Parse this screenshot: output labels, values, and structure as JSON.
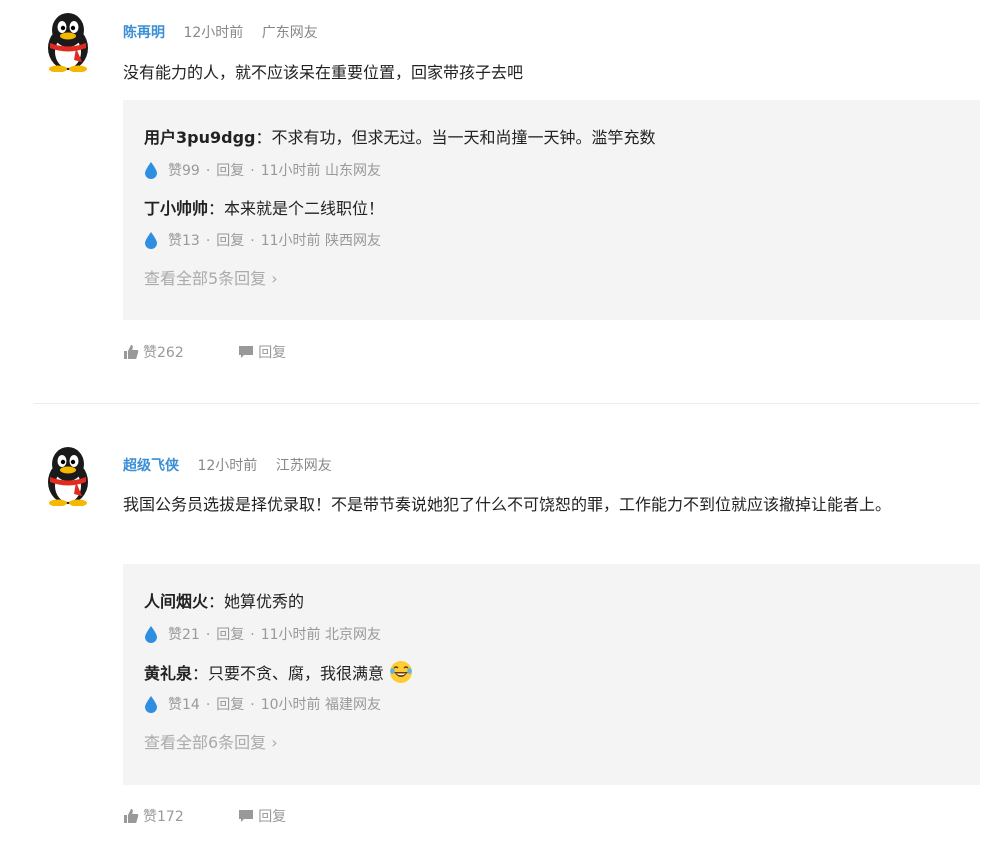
{
  "comments": [
    {
      "author": "陈再明",
      "time": "12小时前",
      "location": "广东网友",
      "text": "没有能力的人，就不应该呆在重要位置，回家带孩子去吧",
      "replies": [
        {
          "author": "用户3pu9dgg",
          "sep": "：",
          "text": "不求有功，但求无过。当一天和尚撞一天钟。滥竽充数",
          "likes": "赞99",
          "dot": "·",
          "reply_label": "回复",
          "time": "11小时前",
          "location": "山东网友"
        },
        {
          "author": "丁小帅帅",
          "sep": "：",
          "text": "本来就是个二线职位！",
          "likes": "赞13",
          "dot": "·",
          "reply_label": "回复",
          "time": "11小时前",
          "location": "陕西网友"
        }
      ],
      "more_replies": "查看全部5条回复",
      "more_chevron": "›",
      "likes": "赞262",
      "reply_label": "回复"
    },
    {
      "author": "超级飞侠",
      "time": "12小时前",
      "location": "江苏网友",
      "text": "我国公务员选拔是择优录取！不是带节奏说她犯了什么不可饶恕的罪，工作能力不到位就应该撤掉让能者上。",
      "replies": [
        {
          "author": "人间烟火",
          "sep": "：",
          "text": "她算优秀的",
          "likes": "赞21",
          "dot": "·",
          "reply_label": "回复",
          "time": "11小时前",
          "location": "北京网友"
        },
        {
          "author": "黄礼泉",
          "sep": "：",
          "text": "只要不贪、腐，我很满意",
          "likes": "赞14",
          "dot": "·",
          "reply_label": "回复",
          "time": "10小时前",
          "location": "福建网友"
        }
      ],
      "more_replies": "查看全部6条回复",
      "more_chevron": "›",
      "likes": "赞172",
      "reply_label": "回复"
    }
  ],
  "icons": {
    "avatar": "qq-penguin-avatar",
    "like": "thumbs-up-icon",
    "reply": "speech-bubble-icon",
    "reply_like": "water-drop-icon",
    "emoji": "laughing-tears-emoji"
  },
  "colors": {
    "author": "#3a8fd6",
    "drop": "#2e8fe0",
    "reply_bg": "#f4f4f4",
    "muted": "#999999"
  }
}
